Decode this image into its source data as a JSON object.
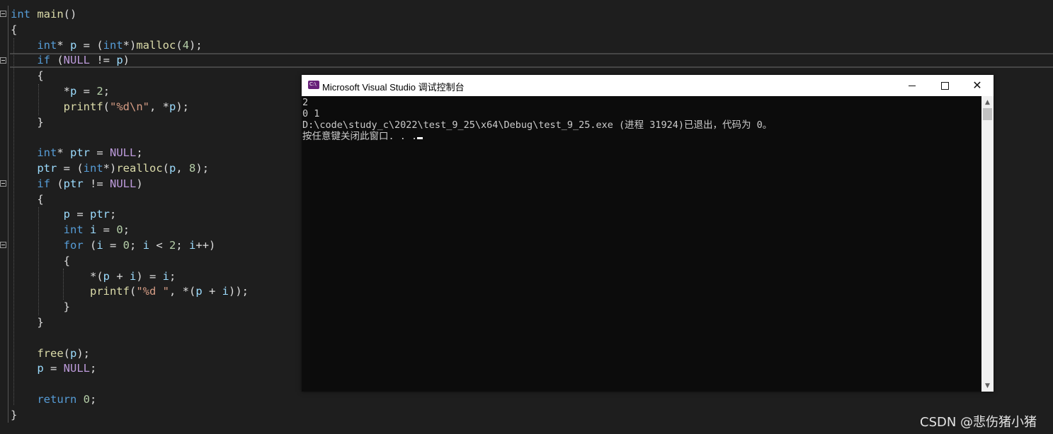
{
  "editor": {
    "lines": [
      [
        {
          "t": "int",
          "c": "kw"
        },
        {
          "t": " "
        },
        {
          "t": "main",
          "c": "fn"
        },
        {
          "t": "()"
        }
      ],
      [
        {
          "t": "{"
        }
      ],
      [
        {
          "t": "    "
        },
        {
          "t": "int",
          "c": "kw"
        },
        {
          "t": "* "
        },
        {
          "t": "p",
          "c": "var"
        },
        {
          "t": " = ("
        },
        {
          "t": "int",
          "c": "kw"
        },
        {
          "t": "*)"
        },
        {
          "t": "malloc",
          "c": "fn"
        },
        {
          "t": "("
        },
        {
          "t": "4",
          "c": "num"
        },
        {
          "t": ");"
        }
      ],
      [
        {
          "t": "    "
        },
        {
          "t": "if",
          "c": "kw"
        },
        {
          "t": " ("
        },
        {
          "t": "NULL",
          "c": "macro"
        },
        {
          "t": " != "
        },
        {
          "t": "p",
          "c": "var"
        },
        {
          "t": ")"
        }
      ],
      [
        {
          "t": "    {"
        }
      ],
      [
        {
          "t": "        *"
        },
        {
          "t": "p",
          "c": "var"
        },
        {
          "t": " = "
        },
        {
          "t": "2",
          "c": "num"
        },
        {
          "t": ";"
        }
      ],
      [
        {
          "t": "        "
        },
        {
          "t": "printf",
          "c": "fn"
        },
        {
          "t": "("
        },
        {
          "t": "\"%d\\n\"",
          "c": "str"
        },
        {
          "t": ", *"
        },
        {
          "t": "p",
          "c": "var"
        },
        {
          "t": ");"
        }
      ],
      [
        {
          "t": "    }"
        }
      ],
      [
        {
          "t": ""
        }
      ],
      [
        {
          "t": "    "
        },
        {
          "t": "int",
          "c": "kw"
        },
        {
          "t": "* "
        },
        {
          "t": "ptr",
          "c": "var"
        },
        {
          "t": " = "
        },
        {
          "t": "NULL",
          "c": "macro"
        },
        {
          "t": ";"
        }
      ],
      [
        {
          "t": "    "
        },
        {
          "t": "ptr",
          "c": "var"
        },
        {
          "t": " = ("
        },
        {
          "t": "int",
          "c": "kw"
        },
        {
          "t": "*)"
        },
        {
          "t": "realloc",
          "c": "fn"
        },
        {
          "t": "("
        },
        {
          "t": "p",
          "c": "var"
        },
        {
          "t": ", "
        },
        {
          "t": "8",
          "c": "num"
        },
        {
          "t": ");"
        }
      ],
      [
        {
          "t": "    "
        },
        {
          "t": "if",
          "c": "kw"
        },
        {
          "t": " ("
        },
        {
          "t": "ptr",
          "c": "var"
        },
        {
          "t": " != "
        },
        {
          "t": "NULL",
          "c": "macro"
        },
        {
          "t": ")"
        }
      ],
      [
        {
          "t": "    {"
        }
      ],
      [
        {
          "t": "        "
        },
        {
          "t": "p",
          "c": "var"
        },
        {
          "t": " = "
        },
        {
          "t": "ptr",
          "c": "var"
        },
        {
          "t": ";"
        }
      ],
      [
        {
          "t": "        "
        },
        {
          "t": "int",
          "c": "kw"
        },
        {
          "t": " "
        },
        {
          "t": "i",
          "c": "var"
        },
        {
          "t": " = "
        },
        {
          "t": "0",
          "c": "num"
        },
        {
          "t": ";"
        }
      ],
      [
        {
          "t": "        "
        },
        {
          "t": "for",
          "c": "kw"
        },
        {
          "t": " ("
        },
        {
          "t": "i",
          "c": "var"
        },
        {
          "t": " = "
        },
        {
          "t": "0",
          "c": "num"
        },
        {
          "t": "; "
        },
        {
          "t": "i",
          "c": "var"
        },
        {
          "t": " < "
        },
        {
          "t": "2",
          "c": "num"
        },
        {
          "t": "; "
        },
        {
          "t": "i",
          "c": "var"
        },
        {
          "t": "++)"
        }
      ],
      [
        {
          "t": "        {"
        }
      ],
      [
        {
          "t": "            *("
        },
        {
          "t": "p",
          "c": "var"
        },
        {
          "t": " + "
        },
        {
          "t": "i",
          "c": "var"
        },
        {
          "t": ") = "
        },
        {
          "t": "i",
          "c": "var"
        },
        {
          "t": ";"
        }
      ],
      [
        {
          "t": "            "
        },
        {
          "t": "printf",
          "c": "fn"
        },
        {
          "t": "("
        },
        {
          "t": "\"%d \"",
          "c": "str"
        },
        {
          "t": ", *("
        },
        {
          "t": "p",
          "c": "var"
        },
        {
          "t": " + "
        },
        {
          "t": "i",
          "c": "var"
        },
        {
          "t": "));"
        }
      ],
      [
        {
          "t": "        }"
        }
      ],
      [
        {
          "t": "    }"
        }
      ],
      [
        {
          "t": ""
        }
      ],
      [
        {
          "t": "    "
        },
        {
          "t": "free",
          "c": "fn"
        },
        {
          "t": "("
        },
        {
          "t": "p",
          "c": "var"
        },
        {
          "t": ");"
        }
      ],
      [
        {
          "t": "    "
        },
        {
          "t": "p",
          "c": "var"
        },
        {
          "t": " = "
        },
        {
          "t": "NULL",
          "c": "macro"
        },
        {
          "t": ";"
        }
      ],
      [
        {
          "t": ""
        }
      ],
      [
        {
          "t": "    "
        },
        {
          "t": "return",
          "c": "kw"
        },
        {
          "t": " "
        },
        {
          "t": "0",
          "c": "num"
        },
        {
          "t": ";"
        }
      ],
      [
        {
          "t": "}"
        }
      ]
    ]
  },
  "console": {
    "title": "Microsoft Visual Studio 调试控制台",
    "icon": "visual-studio-icon",
    "output": [
      "2",
      "0 1",
      "D:\\code\\study_c\\2022\\test_9_25\\x64\\Debug\\test_9_25.exe (进程 31924)已退出，代码为 0。",
      "按任意键关闭此窗口. . ."
    ],
    "buttons": {
      "minimize": "minimize-icon",
      "maximize": "maximize-icon",
      "close": "✕"
    },
    "scrollbar": {
      "up": "▲",
      "down": "▼"
    }
  },
  "watermark": "CSDN @悲伤猪小猪",
  "colors": {
    "keyword": "#569cd6",
    "function": "#dcdcaa",
    "variable": "#9cdcfe",
    "number": "#b5cea8",
    "string": "#d69d85",
    "macro": "#bd9bdb",
    "editor_bg": "#1e1e1e",
    "console_bg": "#0c0c0c"
  }
}
